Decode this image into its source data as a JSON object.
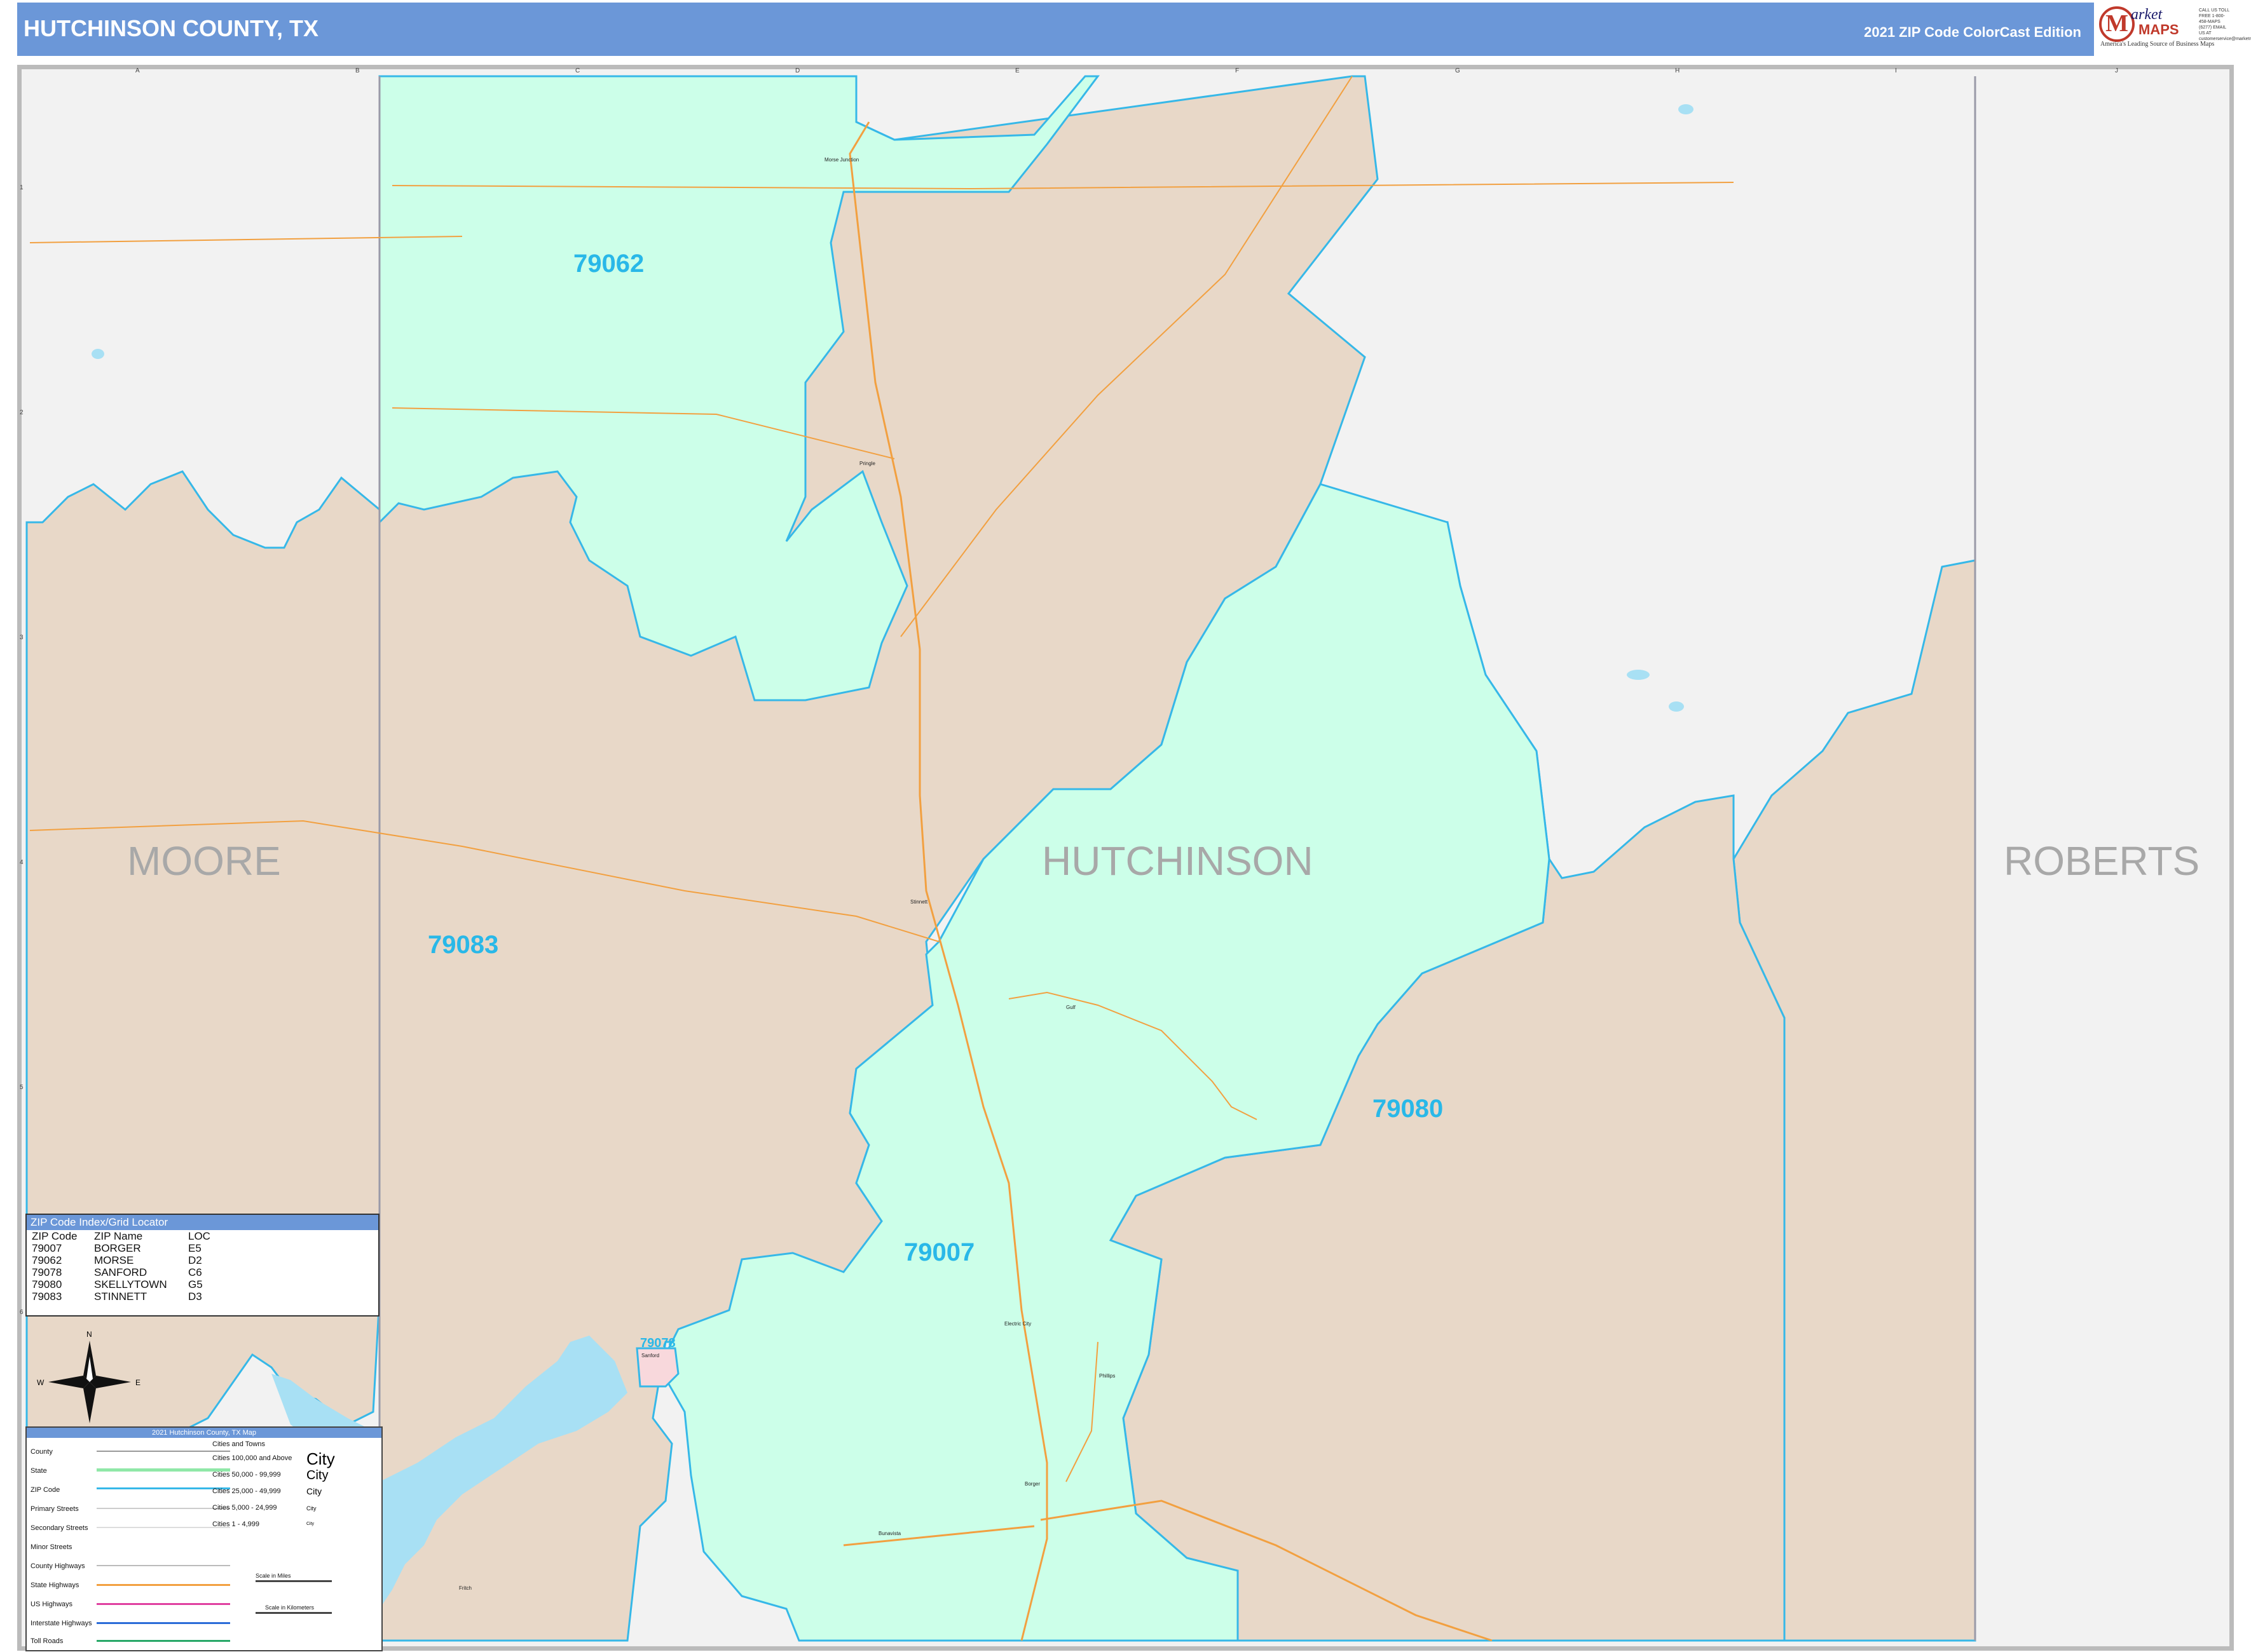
{
  "header": {
    "title": "HUTCHINSON COUNTY, TX",
    "edition": "2021 ZIP Code ColorCast Edition",
    "logo": {
      "mark": "M",
      "brand_top": "arket",
      "brand_bottom": "MAPS",
      "tagline": "America's Leading Source of Business Maps",
      "contact": "CALL US TOLL FREE 1-800-458-MAPS (6277) EMAIL US AT customerservice@marketmaps.com"
    }
  },
  "map": {
    "counties": [
      "MOORE",
      "HUTCHINSON",
      "ROBERTS"
    ],
    "zip_labels": [
      "79062",
      "79083",
      "79080",
      "79007",
      "79078"
    ],
    "places": [
      "Morse Junction",
      "Pringle",
      "Stinnett",
      "Gulf",
      "Electric City",
      "Phillips",
      "Borger",
      "Bunavista",
      "Sanford",
      "Fritch"
    ],
    "grid_letters": [
      "A",
      "B",
      "C",
      "D",
      "E",
      "F",
      "G",
      "H",
      "I",
      "J"
    ],
    "grid_numbers": [
      "1",
      "2",
      "3",
      "4",
      "5",
      "6"
    ],
    "colors": {
      "zip_green": "#ccffe9",
      "zip_tan": "#e8d8c8",
      "outside": "#f2f2f2",
      "zip_border": "#36b8e8",
      "water": "#a8e0f4",
      "highway": "#f2a040",
      "header": "#6b97d8"
    }
  },
  "zip_index": {
    "title": "ZIP Code Index/Grid Locator",
    "columns": [
      "ZIP Code",
      "ZIP Name",
      "LOC"
    ],
    "rows": [
      [
        "79007",
        "BORGER",
        "E5"
      ],
      [
        "79062",
        "MORSE",
        "D2"
      ],
      [
        "79078",
        "SANFORD",
        "C6"
      ],
      [
        "79080",
        "SKELLYTOWN",
        "G5"
      ],
      [
        "79083",
        "STINNETT",
        "D3"
      ]
    ]
  },
  "compass": {
    "n": "N",
    "s": "S",
    "e": "E",
    "w": "W"
  },
  "legend": {
    "title": "2021 Hutchinson County, TX Map",
    "items": [
      "County",
      "State",
      "ZIP Code",
      "Primary Streets",
      "Secondary Streets",
      "Minor Streets",
      "County Highways",
      "State Highways",
      "US Highways",
      "Interstate Highways",
      "Toll Roads"
    ],
    "cities_header": "Cities and Towns",
    "city_sizes": [
      "Cities 100,000 and Above",
      "Cities 50,000 - 99,999",
      "Cities 25,000 - 49,999",
      "Cities 5,000 - 24,999",
      "Cities 1 - 4,999"
    ],
    "city_samples": [
      "City",
      "City",
      "City",
      "City",
      "City"
    ],
    "scale_miles": "Scale in Miles",
    "scale_km": "Scale in Kilometers"
  }
}
